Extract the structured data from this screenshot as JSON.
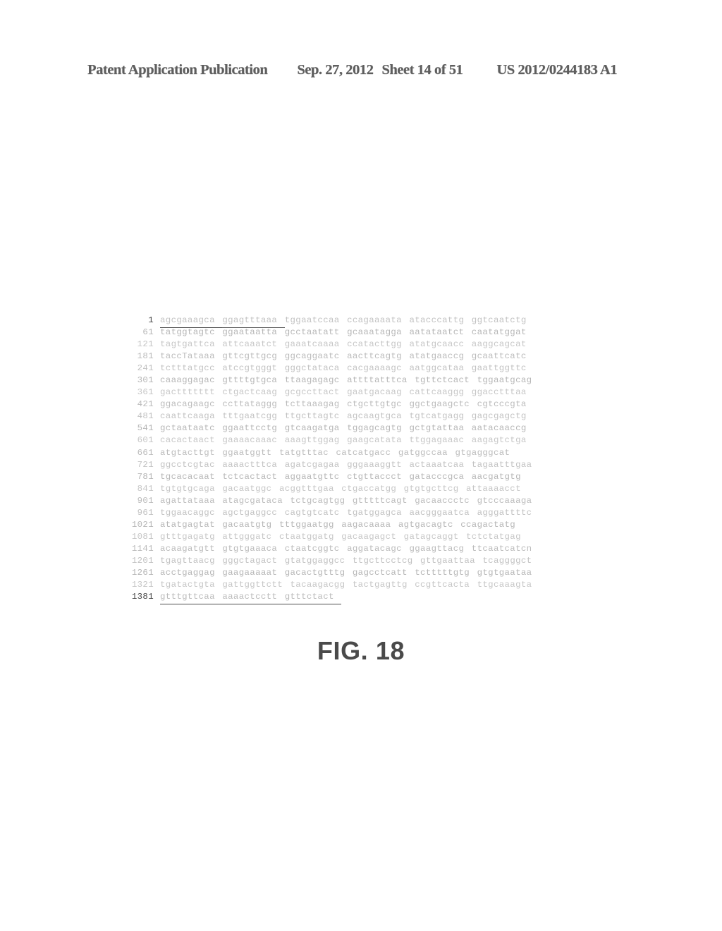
{
  "header": {
    "title": "Patent Application Publication",
    "date": "Sep. 27, 2012",
    "sheet": "Sheet 14 of 51",
    "doc_number": "US 2012/0244183 A1"
  },
  "figure": {
    "caption": "FIG. 18"
  },
  "sequence": {
    "bases_per_line": 60,
    "bases_per_column": 10,
    "columns_per_line": 6,
    "lines": [
      {
        "num": "1",
        "cols": [
          "agcgaaagca",
          "ggagtttaaa",
          "tggaatccaa",
          "ccagaaaata",
          "atacccattg",
          "ggtcaatctg"
        ],
        "emphasis": [
          0,
          1
        ]
      },
      {
        "num": "61",
        "cols": [
          "tatggtagtc",
          "ggaataatta",
          "gcctaatatt",
          "gcaaatagga",
          "aatataatct",
          "caatatggat"
        ],
        "emphasis": []
      },
      {
        "num": "121",
        "cols": [
          "tagtgattca",
          "attcaaatct",
          "gaaatcaaaa",
          "ccatacttgg",
          "atatgcaacc",
          "aaggcagcat"
        ],
        "emphasis": []
      },
      {
        "num": "181",
        "cols": [
          "taccTataaa",
          "gttcgttgcg",
          "ggcaggaatc",
          "aacttcagtg",
          "atatgaaccg",
          "gcaattcatc"
        ],
        "emphasis": []
      },
      {
        "num": "241",
        "cols": [
          "tctttatgcc",
          "atccgtgggt",
          "gggctataca",
          "cacgaaaagc",
          "aatggcataa",
          "gaattggttc"
        ],
        "emphasis": []
      },
      {
        "num": "301",
        "cols": [
          "caaaggagac",
          "gttttgtgca",
          "ttaagagagc",
          "attttatttca",
          "tgttctcact",
          "tggaatgcag"
        ],
        "emphasis": []
      },
      {
        "num": "361",
        "cols": [
          "gacttttttt",
          "ctgactcaag",
          "gcgccttact",
          "gaatgacaag",
          "cattcaaggg",
          "ggacctttaa"
        ],
        "emphasis": []
      },
      {
        "num": "421",
        "cols": [
          "ggacagaagc",
          "ccttataggg",
          "tcttaaagag",
          "ctgcttgtgc",
          "ggctgaagctc",
          "cgtcccgta"
        ],
        "emphasis": []
      },
      {
        "num": "481",
        "cols": [
          "caattcaaga",
          "tttgaatcgg",
          "ttgcttagtc",
          "agcaagtgca",
          "tgtcatgagg",
          "gagcgagctg"
        ],
        "emphasis": []
      },
      {
        "num": "541",
        "cols": [
          "gctaataatc",
          "ggaattcctg",
          "gtcaagatga",
          "tggagcagtg",
          "gctgtattaa",
          "aatacaaccg"
        ],
        "emphasis": []
      },
      {
        "num": "601",
        "cols": [
          "cacactaact",
          "gaaaacaaac",
          "aaagttggag",
          "gaagcatata",
          "ttggagaaac",
          "aagagtctga"
        ],
        "emphasis": []
      },
      {
        "num": "661",
        "cols": [
          "atgtacttgt",
          "ggaatggtt",
          "tatgtttac",
          "catcatgacc",
          "gatggccaa",
          "gtgagggcat"
        ],
        "emphasis": []
      },
      {
        "num": "721",
        "cols": [
          "ggcctcgtac",
          "aaaactttca",
          "agatcgagaa",
          "gggaaaggtt",
          "actaaatcaa",
          "tagaatttgaa"
        ],
        "emphasis": []
      },
      {
        "num": "781",
        "cols": [
          "tgcacacaat",
          "tctcactact",
          "aggaatgttc",
          "ctgttaccct",
          "gatacccgca",
          "aacgatgtg"
        ],
        "emphasis": []
      },
      {
        "num": "841",
        "cols": [
          "tgtgtgcaga",
          "gacaatggc",
          "acggtttgaa",
          "ctgaccatgg",
          "gtgtgcttcg",
          "attaaaacct"
        ],
        "emphasis": []
      },
      {
        "num": "901",
        "cols": [
          "agattataaa",
          "atagcgataca",
          "tctgcagtgg",
          "gtttttcagt",
          "gacaaccctc",
          "gtcccaaaga"
        ],
        "emphasis": []
      },
      {
        "num": "961",
        "cols": [
          "tggaacaggc",
          "agctgaggcc",
          "cagtgtcatc",
          "tgatggagca",
          "aacgggaatca",
          "agggattttc"
        ],
        "emphasis": []
      },
      {
        "num": "1021",
        "cols": [
          "atatgagtat",
          "gacaatgtg",
          "tttggaatgg",
          "aagacaaaa",
          "agtgacagtc",
          "ccagactatg"
        ],
        "emphasis": []
      },
      {
        "num": "1081",
        "cols": [
          "gtttgagatg",
          "attgggatc",
          "ctaatggatg",
          "gacaagagct",
          "gatagcaggt",
          "tctctatgag"
        ],
        "emphasis": []
      },
      {
        "num": "1141",
        "cols": [
          "acaagatgtt",
          "gtgtgaaaca",
          "ctaatcggtc",
          "aggatacagc",
          "ggaagttacg",
          "ttcaatcatcn"
        ],
        "emphasis": []
      },
      {
        "num": "1201",
        "cols": [
          "tgagttaacg",
          "gggctagact",
          "gtatggaggcc",
          "ttgcttcctcg",
          "gttgaattaa",
          "tcaggggct"
        ],
        "emphasis": []
      },
      {
        "num": "1261",
        "cols": [
          "acctgaggag",
          "gaagaaaaat",
          "gacactgtttg",
          "gagcctcatt",
          "tctttttgtg",
          "gtgtgaataa"
        ],
        "emphasis": []
      },
      {
        "num": "1321",
        "cols": [
          "tgatactgta",
          "gattggttctt",
          "tacaagacgg",
          "tactgagttg",
          "ccgttcacta",
          "ttgcaaagta"
        ],
        "emphasis": []
      },
      {
        "num": "1381",
        "cols": [
          "gtttgttcaa",
          "aaaactcctt",
          "gtttctact"
        ],
        "emphasis": [
          0,
          1,
          2
        ]
      }
    ]
  }
}
